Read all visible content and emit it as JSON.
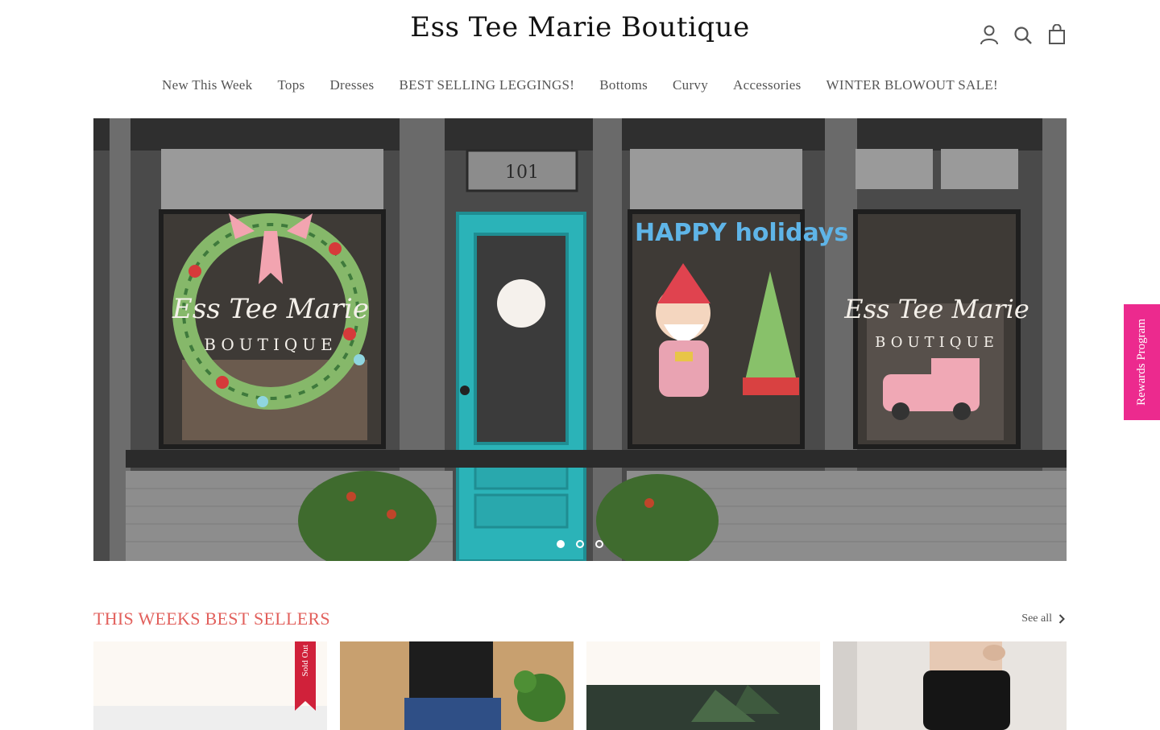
{
  "header": {
    "logo": "Ess Tee Marie Boutique",
    "icons": [
      "account-icon",
      "search-icon",
      "cart-icon"
    ]
  },
  "nav": {
    "items": [
      {
        "label": "New This Week"
      },
      {
        "label": "Tops"
      },
      {
        "label": "Dresses"
      },
      {
        "label": "BEST SELLING LEGGINGS!"
      },
      {
        "label": "Bottoms"
      },
      {
        "label": "Curvy"
      },
      {
        "label": "Accessories"
      },
      {
        "label": "WINTER BLOWOUT SALE!"
      }
    ]
  },
  "hero": {
    "sign_number": "101",
    "window_text_left": "Ess Tee Marie",
    "window_sub_left": "BOUTIQUE",
    "window_text_center": "HAPPY holidays",
    "window_text_right": "Ess Tee Marie",
    "window_sub_right": "BOUTIQUE",
    "slides_count": 3,
    "active_slide": 1
  },
  "rewards": {
    "label": "Rewards Program",
    "color": "#ec2a8e"
  },
  "best_sellers": {
    "title": "THIS WEEKS BEST SELLERS",
    "see_all": "See all",
    "title_color": "#e2605c",
    "products": [
      {
        "badge": "Sold Out"
      },
      {
        "badge": ""
      },
      {
        "badge": ""
      },
      {
        "badge": ""
      }
    ]
  }
}
